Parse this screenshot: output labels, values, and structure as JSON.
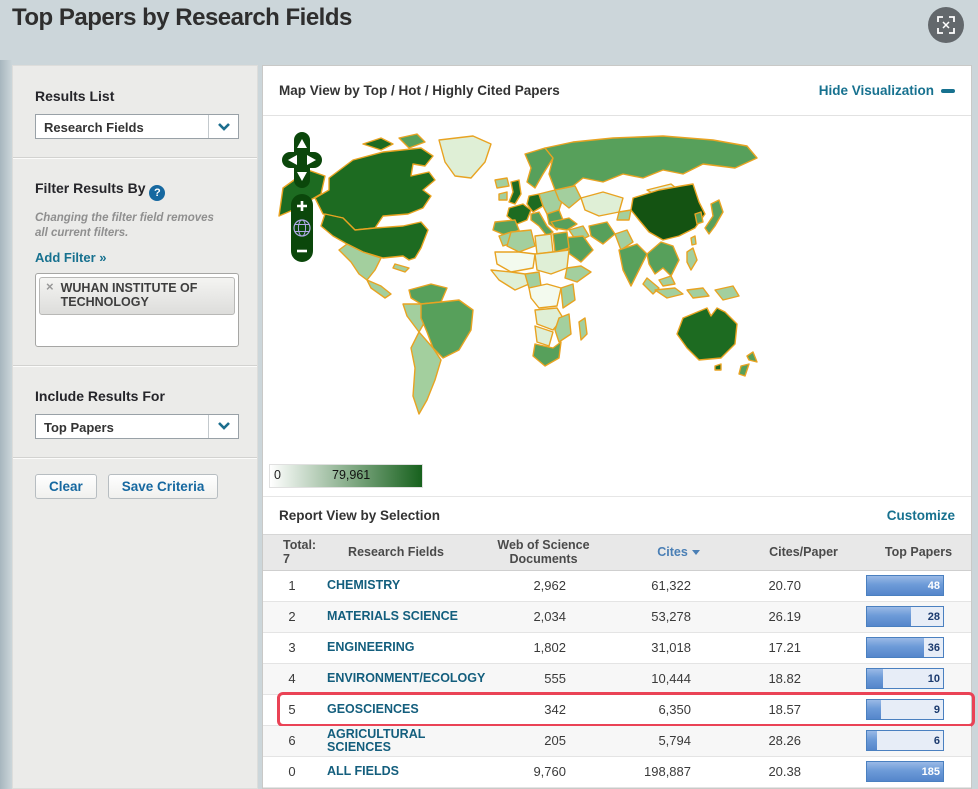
{
  "page": {
    "title": "Top Papers by Research Fields"
  },
  "header": {
    "expand_icon": "fullscreen-expand"
  },
  "sidebar": {
    "results_list": {
      "label": "Results List",
      "selected": "Research Fields"
    },
    "filter": {
      "label": "Filter Results By",
      "help_icon": "?",
      "note": "Changing the filter field removes all current filters.",
      "add_filter_label": "Add Filter »",
      "chip": {
        "remove_icon": "×",
        "label": "WUHAN INSTITUTE OF TECHNOLOGY"
      }
    },
    "include_results": {
      "label": "Include Results For",
      "selected": "Top Papers"
    },
    "actions": {
      "clear_label": "Clear",
      "save_label": "Save Criteria"
    }
  },
  "map_view": {
    "title": "Map View by Top / Hot / Highly Cited Papers",
    "hide_link": "Hide Visualization",
    "legend": {
      "min": "0",
      "max": "79,961"
    },
    "palette": {
      "darkest": "#145312",
      "dark": "#1d6b21",
      "medium": "#57a05b",
      "light": "#a3cf9e",
      "pale": "#dfefd6",
      "faint": "#f3faee",
      "border": "#e8a322",
      "ocean": "#ffffff",
      "control": "#0b470b",
      "legend_dark": "#17611d"
    }
  },
  "report": {
    "title": "Report View by Selection",
    "customize_label": "Customize",
    "total_label": "Total:",
    "total_value": "7",
    "columns": {
      "field": "Research Fields",
      "documents": "Web of Science Documents",
      "cites": "Cites",
      "cites_per_paper": "Cites/Paper",
      "top_papers": "Top Papers"
    },
    "sorted_by": "Cites",
    "rows": [
      {
        "rank": "1",
        "field": "CHEMISTRY",
        "documents": "2,962",
        "cites": "61,322",
        "cites_per_paper": "20.70",
        "top_papers": 48,
        "highlighted": false,
        "is_total": false
      },
      {
        "rank": "2",
        "field": "MATERIALS SCIENCE",
        "documents": "2,034",
        "cites": "53,278",
        "cites_per_paper": "26.19",
        "top_papers": 28,
        "highlighted": false,
        "is_total": false
      },
      {
        "rank": "3",
        "field": "ENGINEERING",
        "documents": "1,802",
        "cites": "31,018",
        "cites_per_paper": "17.21",
        "top_papers": 36,
        "highlighted": false,
        "is_total": false
      },
      {
        "rank": "4",
        "field": "ENVIRONMENT/ECOLOGY",
        "documents": "555",
        "cites": "10,444",
        "cites_per_paper": "18.82",
        "top_papers": 10,
        "highlighted": false,
        "is_total": false
      },
      {
        "rank": "5",
        "field": "GEOSCIENCES",
        "documents": "342",
        "cites": "6,350",
        "cites_per_paper": "18.57",
        "top_papers": 9,
        "highlighted": true,
        "is_total": false
      },
      {
        "rank": "6",
        "field": "AGRICULTURAL SCIENCES",
        "documents": "205",
        "cites": "5,794",
        "cites_per_paper": "28.26",
        "top_papers": 6,
        "highlighted": false,
        "is_total": false
      },
      {
        "rank": "0",
        "field": "ALL FIELDS",
        "documents": "9,760",
        "cites": "198,887",
        "cites_per_paper": "20.38",
        "top_papers": 185,
        "highlighted": false,
        "is_total": true
      }
    ]
  },
  "theme": {
    "accent_link": "#17718f",
    "cites_sort": "#4a7fb5",
    "field_link": "#135e7d",
    "bar_border": "#4a80c0",
    "bar_fill_top": "#9ab9e6",
    "bar_fill_bottom": "#5586cb",
    "bar_track": "#e7edf7",
    "bar_value": "#1b3a6e",
    "highlight": "#ea4356",
    "header_bg": "#e8e8e8"
  }
}
